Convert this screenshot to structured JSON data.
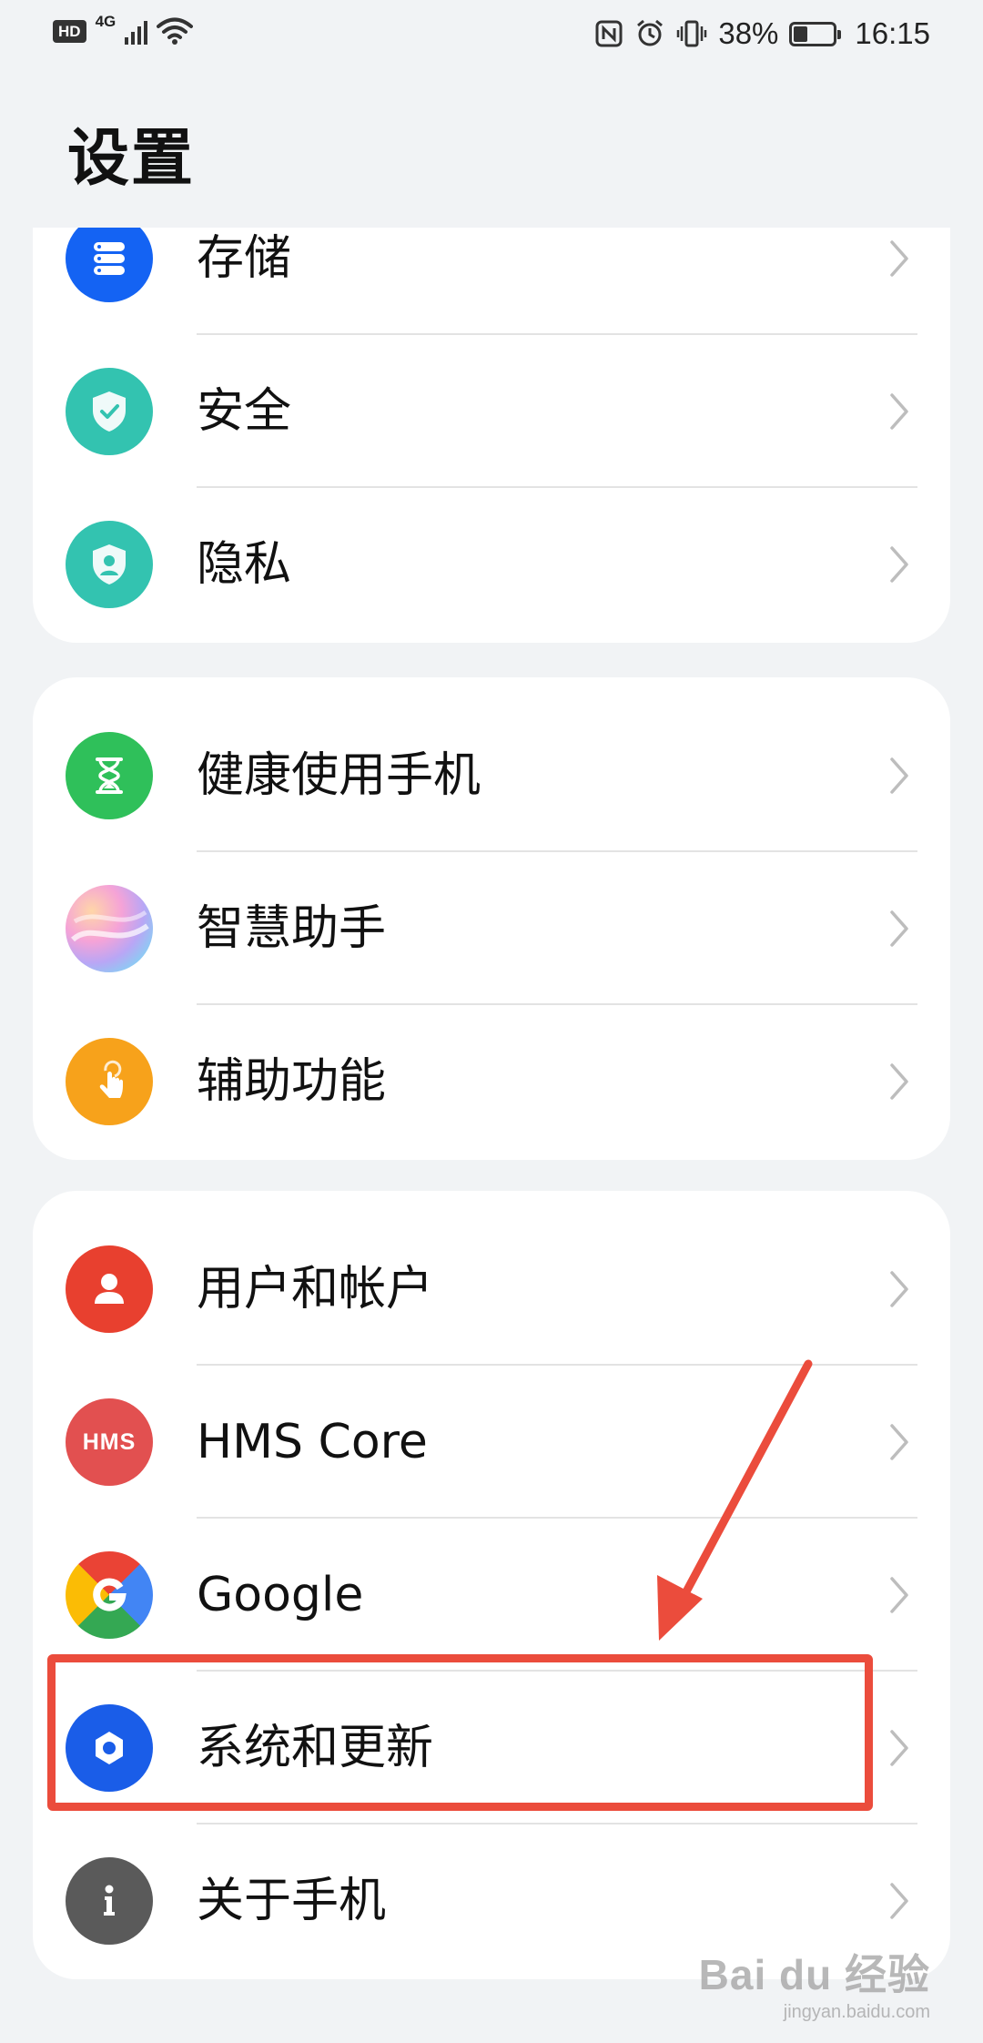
{
  "status_bar": {
    "hd": "HD",
    "network": "4G",
    "battery_percent": "38%",
    "battery_level": 0.38,
    "time": "16:15",
    "icons": [
      "nfc-icon",
      "alarm-icon",
      "vibrate-icon",
      "wifi-icon",
      "signal-icon",
      "battery-icon"
    ]
  },
  "header": {
    "title": "设置"
  },
  "groups": [
    {
      "items": [
        {
          "label": "存储",
          "icon": "storage-icon",
          "color": "#1463f3"
        },
        {
          "label": "安全",
          "icon": "security-shield-icon",
          "color": "#33c3b0"
        },
        {
          "label": "隐私",
          "icon": "privacy-shield-icon",
          "color": "#33c3b0"
        }
      ]
    },
    {
      "items": [
        {
          "label": "健康使用手机",
          "icon": "hourglass-icon",
          "color": "#2fc05a"
        },
        {
          "label": "智慧助手",
          "icon": "assistant-orb-icon",
          "color": "#e8a6d6"
        },
        {
          "label": "辅助功能",
          "icon": "accessibility-hand-icon",
          "color": "#f7a21b"
        }
      ]
    },
    {
      "items": [
        {
          "label": "用户和帐户",
          "icon": "user-icon",
          "color": "#e8402f"
        },
        {
          "label": "HMS Core",
          "icon": "hms-icon",
          "color": "#e25050"
        },
        {
          "label": "Google",
          "icon": "google-icon",
          "color": "#4285f4"
        },
        {
          "label": "系统和更新",
          "icon": "gear-icon",
          "color": "#1a5de8"
        },
        {
          "label": "关于手机",
          "icon": "info-icon",
          "color": "#5a5a5a"
        }
      ]
    }
  ],
  "hms_text": "HMS",
  "annotation": {
    "highlight_color": "#eb4c3c"
  },
  "watermark": {
    "main": "Bai du 经验",
    "sub": "jingyan.baidu.com"
  }
}
